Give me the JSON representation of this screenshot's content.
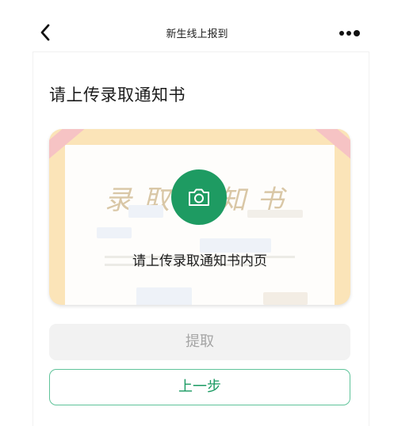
{
  "nav": {
    "title": "新生线上报到",
    "back_icon": "chevron-left-icon",
    "more_icon": "more-dots-icon"
  },
  "main": {
    "heading": "请上传录取通知书",
    "upload_card": {
      "doc_title": "录取通知书",
      "camera_icon": "camera-icon",
      "label": "请上传录取通知书内页"
    },
    "buttons": {
      "extract_label": "提取",
      "prev_label": "上一步"
    }
  },
  "colors": {
    "accent": "#1e9b62",
    "border_accent": "#5fc39a",
    "disabled_bg": "#f2f2f2",
    "disabled_text": "#a5a5a5",
    "card_frame": "#fbe4b8"
  }
}
